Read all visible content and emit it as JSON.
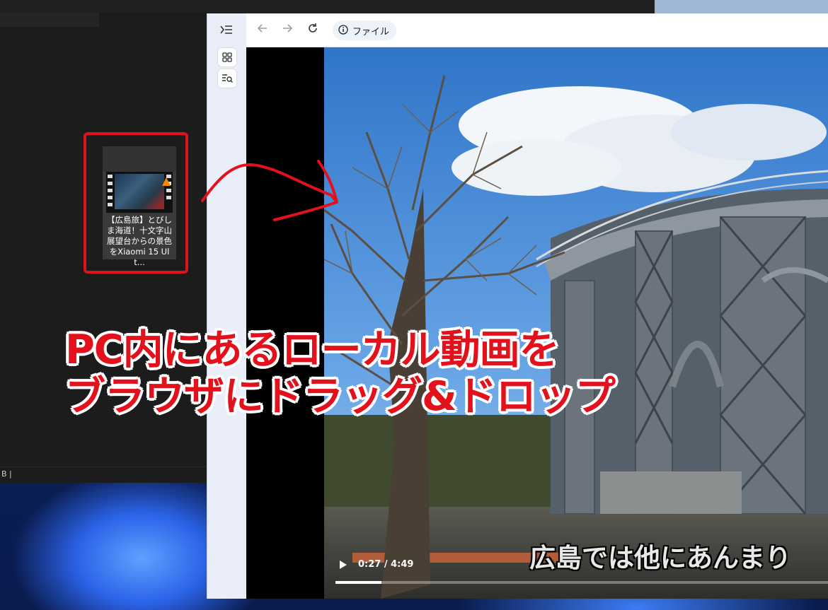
{
  "explorer": {
    "status_text": "B  |",
    "file": {
      "label": "【広島旅】とびしま海道！十文字山展望台からの景色をXiaomi 15 Ult..."
    }
  },
  "browser": {
    "address_label": "ファイル",
    "video": {
      "time": "0:27 / 4:49",
      "progress": 0.094,
      "caption": "広島では他にあんまり"
    }
  },
  "annotation": {
    "line1": "PC内にあるローカル動画を",
    "line2": "ブラウザにドラッグ&ドロップ",
    "color": "#e2111c"
  },
  "icons": {
    "sidepanel_toggle": "sidebar-expand-icon",
    "apps": "grid-icon",
    "search": "list-search-icon",
    "back": "arrow-left-icon",
    "forward": "arrow-right-icon",
    "reload": "reload-icon",
    "info": "info-icon",
    "play": "play-icon"
  }
}
